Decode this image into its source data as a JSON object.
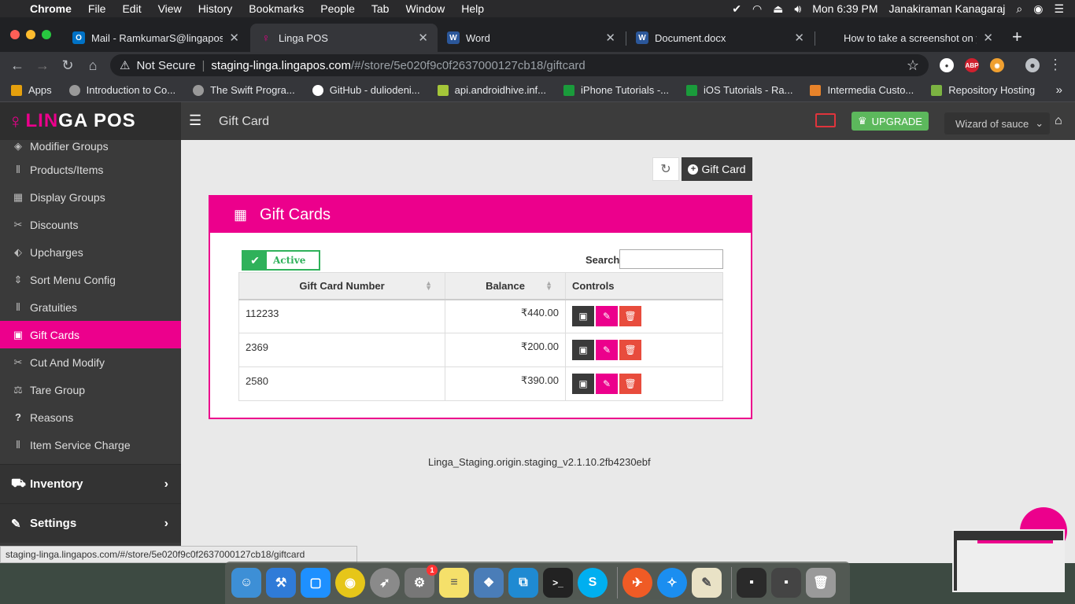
{
  "menubar": {
    "app": "Chrome",
    "items": [
      "File",
      "Edit",
      "View",
      "History",
      "Bookmarks",
      "People",
      "Tab",
      "Window",
      "Help"
    ],
    "clock": "Mon 6:39 PM",
    "user": "Janakiraman Kanagaraj"
  },
  "tabs": [
    {
      "title": "Mail - RamkumarS@lingapos.co",
      "icon": "outlook-icon",
      "color": "#0072c6",
      "glyph": "O"
    },
    {
      "title": "Linga POS",
      "icon": "linga-icon",
      "color": "#ec008c",
      "glyph": "L"
    },
    {
      "title": "Word",
      "icon": "word-icon",
      "color": "#2b579a",
      "glyph": "W"
    },
    {
      "title": "Document.docx",
      "icon": "word-icon",
      "color": "#2b579a",
      "glyph": "W"
    },
    {
      "title": "How to take a screenshot on yo",
      "icon": "apple-icon",
      "color": "#555555",
      "glyph": ""
    }
  ],
  "address": {
    "security": "Not Secure",
    "host": "staging-linga.lingapos.com",
    "path": "/#/store/5e020f9c0f2637000127cb18/giftcard"
  },
  "bookmarks": [
    {
      "label": "Apps",
      "color": "#e5a00d"
    },
    {
      "label": "Introduction to Co...",
      "color": "#999999"
    },
    {
      "label": "The Swift Progra...",
      "color": "#999999"
    },
    {
      "label": "GitHub - duliodeni...",
      "color": "#ffffff"
    },
    {
      "label": "api.androidhive.inf...",
      "color": "#a4c639"
    },
    {
      "label": "iPhone Tutorials -...",
      "color": "#1a9b3b"
    },
    {
      "label": "iOS Tutorials - Ra...",
      "color": "#1a9b3b"
    },
    {
      "label": "Intermedia Custo...",
      "color": "#e8832a"
    },
    {
      "label": "Repository Hosting",
      "color": "#7cb342"
    }
  ],
  "header": {
    "logo_a": "LIN",
    "logo_b": "GA POS",
    "page_title": "Gift Card",
    "upgrade": "UPGRADE",
    "store": "Wizard of sauce"
  },
  "sidebar": {
    "items": [
      {
        "label": "Modifier Groups",
        "icon": "basket-icon",
        "glyph": "◈"
      },
      {
        "label": "Products/Items",
        "icon": "utensils-icon",
        "glyph": "⫴"
      },
      {
        "label": "Display Groups",
        "icon": "grid-icon",
        "glyph": "▦"
      },
      {
        "label": "Discounts",
        "icon": "discount-icon",
        "glyph": "✂"
      },
      {
        "label": "Upcharges",
        "icon": "tag-icon",
        "glyph": "⬖"
      },
      {
        "label": "Sort Menu Config",
        "icon": "sort-icon",
        "glyph": "⇕"
      },
      {
        "label": "Gratuities",
        "icon": "gratuity-icon",
        "glyph": "⫴"
      },
      {
        "label": "Gift Cards",
        "icon": "gift-icon",
        "glyph": "▣"
      },
      {
        "label": "Cut And Modify",
        "icon": "cut-icon",
        "glyph": "✂"
      },
      {
        "label": "Tare Group",
        "icon": "scale-icon",
        "glyph": "⚖"
      },
      {
        "label": "Reasons",
        "icon": "question-icon",
        "glyph": "?"
      },
      {
        "label": "Item Service Charge",
        "icon": "service-icon",
        "glyph": "⫴"
      }
    ],
    "active_index": 7,
    "groups": [
      {
        "label": "Inventory",
        "icon": "basket-icon",
        "glyph": "⛟"
      },
      {
        "label": "Settings",
        "icon": "wrench-icon",
        "glyph": "✎"
      }
    ]
  },
  "toolbar": {
    "add_label": "Gift Card"
  },
  "panel": {
    "title": "Gift Cards",
    "active_label": "Active",
    "search_label": "Search",
    "search_value": "",
    "columns": [
      "Gift Card Number",
      "Balance",
      "Controls"
    ],
    "rows": [
      {
        "number": "112233",
        "balance": "₹440.00"
      },
      {
        "number": "2369",
        "balance": "₹200.00"
      },
      {
        "number": "2580",
        "balance": "₹390.00"
      }
    ]
  },
  "version": "Linga_Staging.origin.staging_v2.1.10.2fb4230ebf",
  "status_url": "staging-linga.lingapos.com/#/store/5e020f9c0f2637000127cb18/giftcard",
  "dock": [
    {
      "name": "finder-icon",
      "color": "#3d8fd6"
    },
    {
      "name": "xcode-icon",
      "color": "#2f7bd8"
    },
    {
      "name": "simulator-icon",
      "color": "#1e90ff"
    },
    {
      "name": "chrome-icon",
      "color": "#e6c619"
    },
    {
      "name": "launchpad-icon",
      "color": "#8a8a8a"
    },
    {
      "name": "system-preferences-icon",
      "color": "#777777",
      "badge": "1"
    },
    {
      "name": "notes-icon",
      "color": "#f5e06a"
    },
    {
      "name": "preview-icon",
      "color": "#4a7db8"
    },
    {
      "name": "vscode-icon",
      "color": "#1f8ad2"
    },
    {
      "name": "terminal-icon",
      "color": "#222222"
    },
    {
      "name": "skype-icon",
      "color": "#00aff0"
    },
    {
      "name": "postman-icon",
      "color": "#ef5b25"
    },
    {
      "name": "safari-icon",
      "color": "#1b8ef0"
    },
    {
      "name": "textedit-icon",
      "color": "#e9e2c6"
    },
    {
      "name": "screenshot-icon",
      "color": "#2a2a2a"
    },
    {
      "name": "screenshot-icon",
      "color": "#444444"
    },
    {
      "name": "trash-icon",
      "color": "#9a9a9a"
    }
  ]
}
